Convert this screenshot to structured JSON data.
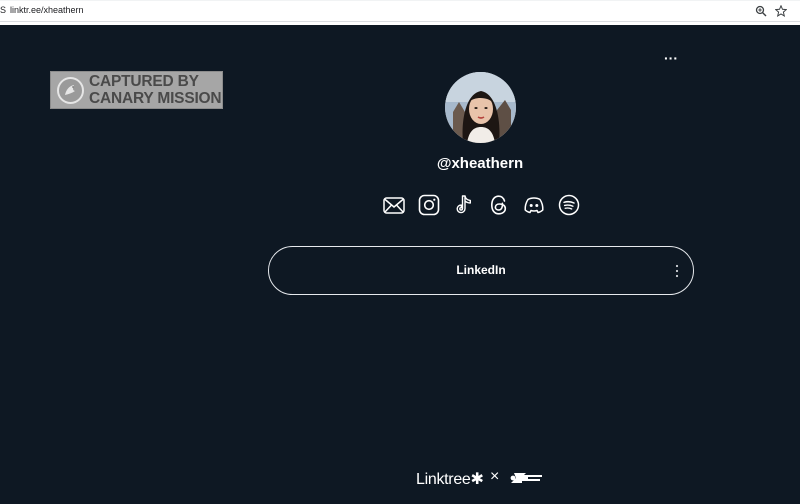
{
  "browser": {
    "url": "linktr.ee/xheathern",
    "url_edge": "S",
    "icons": [
      "zoom-icon",
      "star-icon"
    ]
  },
  "watermark": {
    "line1": "CAPTURED BY",
    "line2": "CANARY MISSION"
  },
  "profile": {
    "more_label": "···",
    "username": "@xheathern"
  },
  "social": [
    "email-icon",
    "instagram-icon",
    "tiktok-icon",
    "threads-icon",
    "discord-icon",
    "spotify-icon"
  ],
  "links": [
    {
      "label": "LinkedIn",
      "menu": "⋮"
    }
  ],
  "footer": {
    "brand": "Linktree✱",
    "separator": "×"
  },
  "colors": {
    "background": "#0e1823",
    "text": "#ffffff",
    "card_border": "#e6e9ed"
  }
}
